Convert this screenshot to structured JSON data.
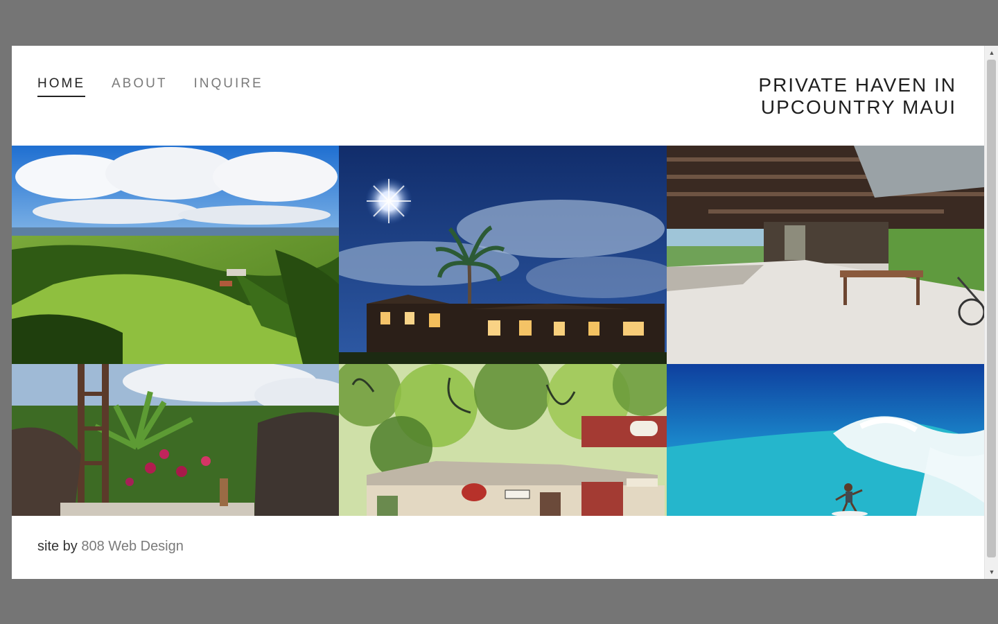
{
  "nav": {
    "items": [
      {
        "label": "HOME",
        "active": true
      },
      {
        "label": "ABOUT",
        "active": false
      },
      {
        "label": "INQUIRE",
        "active": false
      }
    ]
  },
  "site_title": {
    "line1": "PRIVATE HAVEN IN",
    "line2": "UPCOUNTRY MAUI"
  },
  "gallery": {
    "photos": [
      {
        "name": "aerial-estate-photo"
      },
      {
        "name": "night-house-palm-photo"
      },
      {
        "name": "open-pavilion-interior-photo"
      },
      {
        "name": "tropical-garden-photo"
      },
      {
        "name": "town-storefront-painting"
      },
      {
        "name": "surfer-wave-photo"
      }
    ]
  },
  "footer": {
    "prefix": "site by",
    "link": "808 Web Design"
  },
  "colors": {
    "background": "#757575",
    "text": "#222222",
    "muted": "#7a7a7a"
  }
}
